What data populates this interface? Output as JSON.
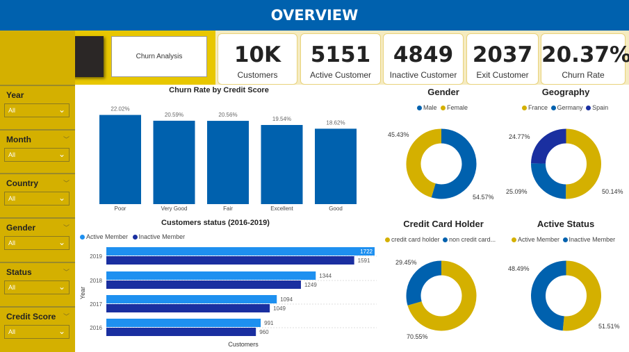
{
  "header": {
    "title": "OVERVIEW"
  },
  "nav": {
    "overview_label": "Overview",
    "churn_label": "Churn Analysis"
  },
  "kpis": [
    {
      "value": "10K",
      "label": "Customers"
    },
    {
      "value": "5151",
      "label": "Active Customer"
    },
    {
      "value": "4849",
      "label": "Inactive Customer"
    },
    {
      "value": "2037",
      "label": "Exit Customer"
    },
    {
      "value": "20.37%",
      "label": "Churn Rate"
    }
  ],
  "slicers": [
    {
      "title": "Year",
      "value": "All"
    },
    {
      "title": "Month",
      "value": "All"
    },
    {
      "title": "Country",
      "value": "All"
    },
    {
      "title": "Gender",
      "value": "All"
    },
    {
      "title": "Status",
      "value": "All"
    },
    {
      "title": "Credit Score",
      "value": "All"
    }
  ],
  "colors": {
    "primary": "#0061AE",
    "yellow": "#D4B000",
    "light_blue": "#1E90F0",
    "dark_blue": "#1A2FA0"
  },
  "chart_data": [
    {
      "type": "bar",
      "title": "Churn Rate by Credit Score",
      "categories": [
        "Poor",
        "Very Good",
        "Fair",
        "Excellent",
        "Good"
      ],
      "values": [
        22.02,
        20.59,
        20.56,
        19.54,
        18.62
      ],
      "labels": [
        "22.02%",
        "20.59%",
        "20.56%",
        "19.54%",
        "18.62%"
      ],
      "color": "#0061AE"
    },
    {
      "type": "bar",
      "orientation": "horizontal",
      "title": "Customers status (2016-2019)",
      "categories": [
        "2019",
        "2018",
        "2017",
        "2016"
      ],
      "series": [
        {
          "name": "Active Member",
          "values": [
            1722,
            1344,
            1094,
            991
          ],
          "color": "#1E90F0"
        },
        {
          "name": "Inactive Member",
          "values": [
            1591,
            1249,
            1049,
            960
          ],
          "color": "#1A2FA0"
        }
      ],
      "xlabel": "Customers",
      "ylabel": "Year",
      "xlim": [
        0,
        2000
      ]
    },
    {
      "type": "pie",
      "title": "Gender",
      "labels": [
        "Male",
        "Female"
      ],
      "values": [
        54.57,
        45.43
      ],
      "value_labels": [
        "54.57%",
        "45.43%"
      ],
      "colors": [
        "#0061AE",
        "#D4B000"
      ]
    },
    {
      "type": "pie",
      "title": "Geography",
      "labels": [
        "France",
        "Germany",
        "Spain"
      ],
      "values": [
        50.14,
        25.09,
        24.77
      ],
      "value_labels": [
        "50.14%",
        "25.09%",
        "24.77%"
      ],
      "colors": [
        "#D4B000",
        "#0061AE",
        "#1A2FA0"
      ]
    },
    {
      "type": "pie",
      "title": "Credit Card Holder",
      "labels": [
        "credit card holder",
        "non credit card..."
      ],
      "values": [
        70.55,
        29.45
      ],
      "value_labels": [
        "70.55%",
        "29.45%"
      ],
      "colors": [
        "#D4B000",
        "#0061AE"
      ]
    },
    {
      "type": "pie",
      "title": "Active Status",
      "labels": [
        "Active Member",
        "Inactive Member"
      ],
      "values": [
        51.51,
        48.49
      ],
      "value_labels": [
        "51.51%",
        "48.49%"
      ],
      "colors": [
        "#D4B000",
        "#0061AE"
      ]
    }
  ]
}
